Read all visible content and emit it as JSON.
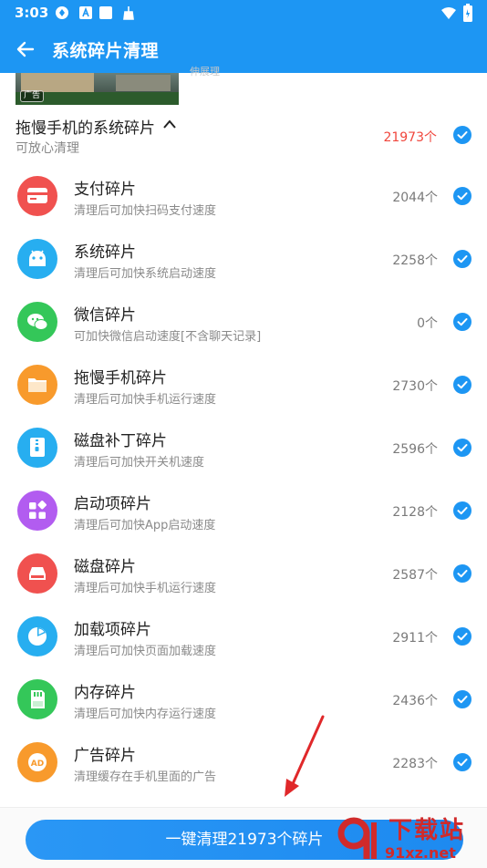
{
  "status_bar": {
    "time": "3:03"
  },
  "header": {
    "title": "系统碎片清理"
  },
  "ad": {
    "tag": "广告",
    "text": "伸展理"
  },
  "group": {
    "title": "拖慢手机的系统碎片",
    "subtitle": "可放心清理",
    "count": "21973个"
  },
  "items": [
    {
      "name": "支付碎片",
      "desc": "清理后可加快扫码支付速度",
      "count": "2044个",
      "icon": "payment-card-icon",
      "color": "#f0514f"
    },
    {
      "name": "系统碎片",
      "desc": "清理后可加快系统启动速度",
      "count": "2258个",
      "icon": "android-icon",
      "color": "#27aef0"
    },
    {
      "name": "微信碎片",
      "desc": "可加快微信启动速度[不含聊天记录]",
      "count": "0个",
      "icon": "wechat-icon",
      "color": "#34c759"
    },
    {
      "name": "拖慢手机碎片",
      "desc": "清理后可加快手机运行速度",
      "count": "2730个",
      "icon": "folder-icon",
      "color": "#f89a2c"
    },
    {
      "name": "磁盘补丁碎片",
      "desc": "清理后可加快开关机速度",
      "count": "2596个",
      "icon": "zip-file-icon",
      "color": "#27aef0"
    },
    {
      "name": "启动项碎片",
      "desc": "清理后可加快App启动速度",
      "count": "2128个",
      "icon": "app-grid-icon",
      "color": "#b25cf0"
    },
    {
      "name": "磁盘碎片",
      "desc": "清理后可加快手机运行速度",
      "count": "2587个",
      "icon": "disk-icon",
      "color": "#f0514f"
    },
    {
      "name": "加载项碎片",
      "desc": "清理后可加快页面加载速度",
      "count": "2911个",
      "icon": "pie-chart-icon",
      "color": "#27aef0"
    },
    {
      "name": "内存碎片",
      "desc": "清理后可加快内存运行速度",
      "count": "2436个",
      "icon": "sd-card-icon",
      "color": "#34c759"
    },
    {
      "name": "广告碎片",
      "desc": "清理缓存在手机里面的广告",
      "count": "2283个",
      "icon": "ad-icon",
      "color": "#f89a2c"
    }
  ],
  "bottom": {
    "button_label": "一键清理21973个碎片"
  },
  "watermark": {
    "text": "下载站",
    "url": "91xz.net"
  },
  "colors": {
    "accent": "#1d96f3",
    "count_red": "#f0463c"
  }
}
